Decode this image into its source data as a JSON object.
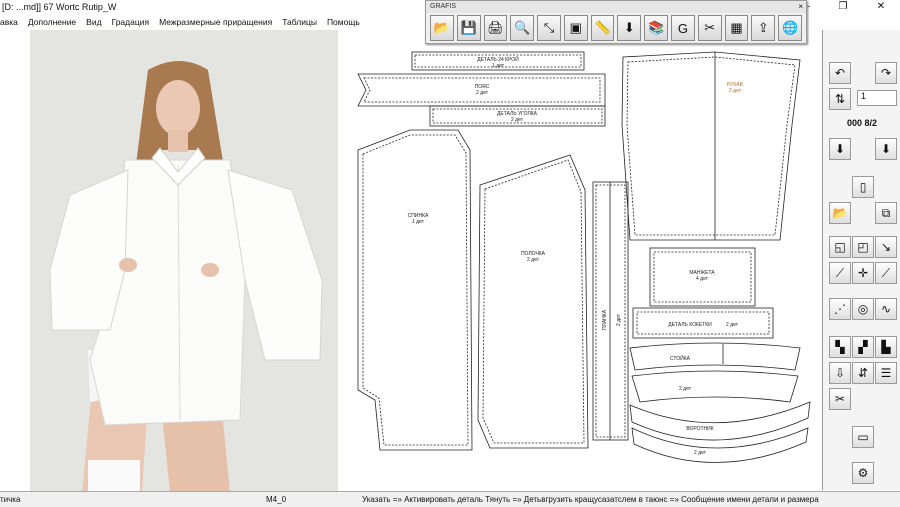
{
  "window": {
    "title": "[D: ...md]]    67 Wortc Rutip_W",
    "minimize": "—",
    "maximize": "❐",
    "close": "✕"
  },
  "menu": {
    "items": [
      "авка",
      "Дополнение",
      "Вид",
      "Градация",
      "Межразмерные приращения",
      "Таблицы",
      "Помощь"
    ]
  },
  "palette": {
    "title": "GRAFIS",
    "close": "×",
    "tools": [
      "open-folder-icon",
      "save-icon",
      "print-icon",
      "zoom-icon",
      "scale-icon",
      "select-icon",
      "measure-icon",
      "download-icon",
      "stack-icon",
      "text-icon",
      "cut-icon",
      "table-icon",
      "export-icon",
      "globe-icon"
    ]
  },
  "pieces": [
    {
      "l1": "ДЕТАЛЬ 24  КРОЙ",
      "l2": "1 дет"
    },
    {
      "l1": "ПОЯС",
      "l2": "2 дет"
    },
    {
      "l1": "ДЕТАЛЬ УГОЛКА",
      "l2": "2 дет"
    },
    {
      "l1": "РУКАВ",
      "l2": "2 дет"
    },
    {
      "l1": "СПИНКА",
      "l2": "1 дет"
    },
    {
      "l1": "ПОЛОЧКА",
      "l2": "2 дет"
    },
    {
      "l1": "ПЛАНКА",
      "l2": "2 дет"
    },
    {
      "l1": "МАНЖЕТА",
      "l2": "4 дет"
    },
    {
      "l1": "ДЕТАЛЬ КОКЕТКИ",
      "l2": "2 дет"
    },
    {
      "l1": "СТОЙКА",
      "l2": "2 дет"
    },
    {
      "l1": "ВОРОТНИК",
      "l2": "2 дет"
    }
  ],
  "right_panel": {
    "spin_value": "1",
    "size_label": "000 8/2"
  },
  "status": {
    "left": "тичка",
    "cell": "М4_0",
    "instruction": "Указать =» Активировать деталь Тянуть =» Детьвгрузить кращусазатслем в таюнс =» Сообщение имени детали и размера"
  }
}
